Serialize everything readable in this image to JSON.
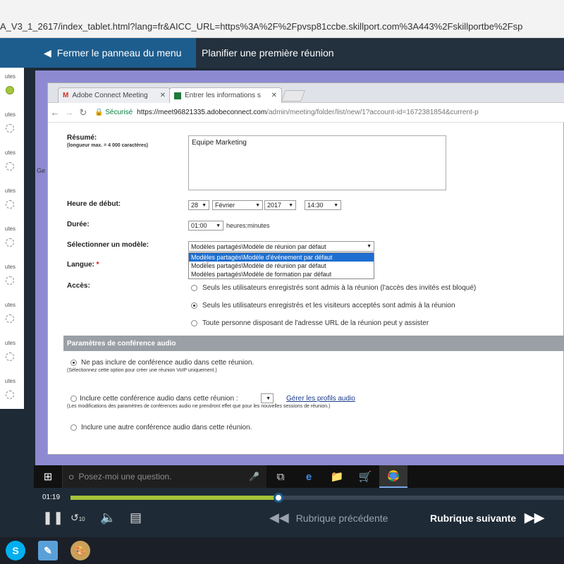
{
  "browser": {
    "url": "A_V3_1_2617/index_tablet.html?lang=fr&AICC_URL=https%3A%2F%2Fpvsp81ccbe.skillport.com%3A443%2Fskillportbe%2Fsp"
  },
  "nav": {
    "back_label": "Fermer le panneau du menu",
    "title": "Planifier une première réunion"
  },
  "sidebar": {
    "items": [
      {
        "label": "utes",
        "status": "done"
      },
      {
        "label": "utes",
        "status": "pending"
      },
      {
        "label": "utes",
        "status": "pending"
      },
      {
        "label": "utes",
        "status": "pending"
      },
      {
        "label": "utes",
        "status": "pending"
      },
      {
        "label": "utes",
        "status": "pending"
      },
      {
        "label": "utes",
        "status": "pending"
      },
      {
        "label": "utes",
        "status": "pending"
      },
      {
        "label": "utes",
        "status": "pending"
      }
    ]
  },
  "side_text": "Ge",
  "inner_browser": {
    "tabs": [
      {
        "label": "Adobe Connect Meeting",
        "icon": "gmail-icon"
      },
      {
        "label": "Entrer les informations s",
        "icon": "adobe-connect-icon"
      }
    ],
    "secure_label": "Sécurisé",
    "url_host": "https://meet96821335.adobeconnect.com",
    "url_path": "/admin/meeting/folder/list/new/1?account-id=1672381854&current-p"
  },
  "form": {
    "resume_label": "Résumé:",
    "resume_hint": "(longueur max. = 4 000 caractères)",
    "resume_value": "Equipe Marketing",
    "start_label": "Heure de début:",
    "start_day": "28",
    "start_month": "Février",
    "start_year": "2017",
    "start_time": "14:30",
    "duration_label": "Durée:",
    "duration_value": "01:00",
    "duration_unit": "heures:minutes",
    "template_label": "Sélectionner un modèle:",
    "template_selected": "Modèles partagés\\Modèle de réunion par défaut",
    "template_options": [
      "Modèles partagés\\Modèle d'événement par défaut",
      "Modèles partagés\\Modèle de réunion par défaut",
      "Modèles partagés\\Modèle de formation par défaut"
    ],
    "language_label": "Langue:",
    "required_mark": "*",
    "access_label": "Accès:",
    "access_options": [
      "Seuls les utilisateurs enregistrés sont admis à la réunion (l'accès des invités est bloqué)",
      "Seuls les utilisateurs enregistrés et les visiteurs acceptés sont admis à la réunion",
      "Toute personne disposant de l'adresse URL de la réunion peut y assister"
    ],
    "audio_section_title": "Paramètres de conférence audio",
    "audio_opt1": "Ne pas inclure de conférence audio dans cette réunion.",
    "audio_opt1_sub": "(Sélectionnez cette option pour créer une réunion VoIP uniquement.)",
    "audio_opt2": "Inclure cette conférence audio dans cette réunion :",
    "audio_opt2_link": "Gérer les profils audio",
    "audio_opt2_sub": "(Les modifications des paramètres de conférences audio ne prendront effet que pour les nouvelles sessions de réunion.)",
    "audio_opt3": "Inclure une autre conférence audio dans cette réunion."
  },
  "taskbar": {
    "search_placeholder": "Posez-moi une question."
  },
  "player": {
    "time": "01:19",
    "progress": 0.422,
    "prev_label": "Rubrique précédente",
    "next_label": "Rubrique suivante",
    "replay_label": "10"
  }
}
